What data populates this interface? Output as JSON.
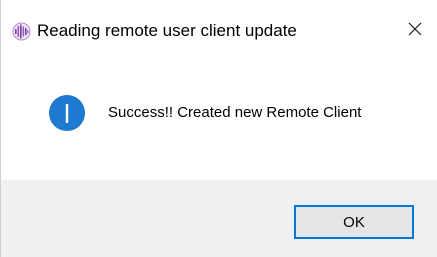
{
  "window": {
    "title": "Reading remote user client update",
    "app_icon": "audio-wave-app-icon",
    "close_icon": "close-icon"
  },
  "message": {
    "icon": "info-icon",
    "text": "Success!! Created new Remote Client"
  },
  "buttons": {
    "ok_label": "OK"
  },
  "colors": {
    "accent": "#0078d7",
    "footer_bg": "#f0f0f0",
    "button_bg": "#e5e5e5"
  }
}
